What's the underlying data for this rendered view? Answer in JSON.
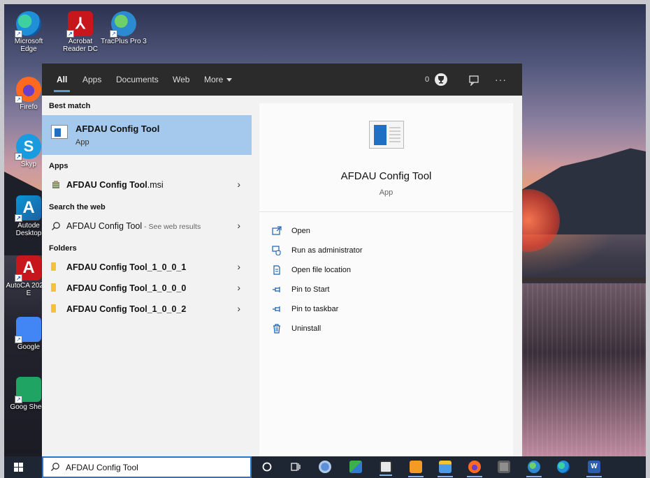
{
  "desktop": {
    "icons": [
      {
        "label": "Microsoft Edge",
        "icon": "edge-icon"
      },
      {
        "label": "Acrobat Reader DC",
        "icon": "acrobat-icon"
      },
      {
        "label": "TracPlus Pro 3",
        "icon": "globe-app-icon"
      },
      {
        "label": "Firefo",
        "icon": "firefox-icon"
      },
      {
        "label": "Skyp",
        "icon": "skype-icon"
      },
      {
        "label": "Autode Desktop",
        "icon": "autodesk-icon"
      },
      {
        "label": "AutoCA 2021 - E",
        "icon": "autocad-icon"
      },
      {
        "label": "Google",
        "icon": "google-docs-icon"
      },
      {
        "label": "Goog Sheet",
        "icon": "google-sheets-icon"
      }
    ]
  },
  "search_panel": {
    "tabs": [
      {
        "label": "All",
        "active": true
      },
      {
        "label": "Apps"
      },
      {
        "label": "Documents"
      },
      {
        "label": "Web"
      },
      {
        "label": "More"
      }
    ],
    "points": "0",
    "best_match": {
      "heading": "Best match",
      "name": "AFDAU Config Tool",
      "type": "App"
    },
    "apps": {
      "heading": "Apps",
      "items": [
        {
          "name_bold": "AFDAU Config Tool",
          "name_rest": ".msi"
        }
      ]
    },
    "web": {
      "heading": "Search the web",
      "query": "AFDAU Config Tool",
      "hint": " - See web results"
    },
    "folders": {
      "heading": "Folders",
      "items": [
        {
          "name": "AFDAU Config Tool_1_0_0_1"
        },
        {
          "name": "AFDAU Config Tool_1_0_0_0"
        },
        {
          "name": "AFDAU Config Tool_1_0_0_2"
        }
      ]
    },
    "preview": {
      "title": "AFDAU Config Tool",
      "type": "App",
      "actions": [
        {
          "label": "Open",
          "icon": "open-window-icon"
        },
        {
          "label": "Run as administrator",
          "icon": "shield-admin-icon"
        },
        {
          "label": "Open file location",
          "icon": "file-location-icon"
        },
        {
          "label": "Pin to Start",
          "icon": "pin-icon"
        },
        {
          "label": "Pin to taskbar",
          "icon": "pin-icon"
        },
        {
          "label": "Uninstall",
          "icon": "trash-icon"
        }
      ]
    }
  },
  "taskbar": {
    "search_value": "AFDAU Config Tool",
    "colors": {
      "accent": "#2d73c6",
      "bar": "#1f2633",
      "highlight": "#a4c9ec"
    }
  }
}
